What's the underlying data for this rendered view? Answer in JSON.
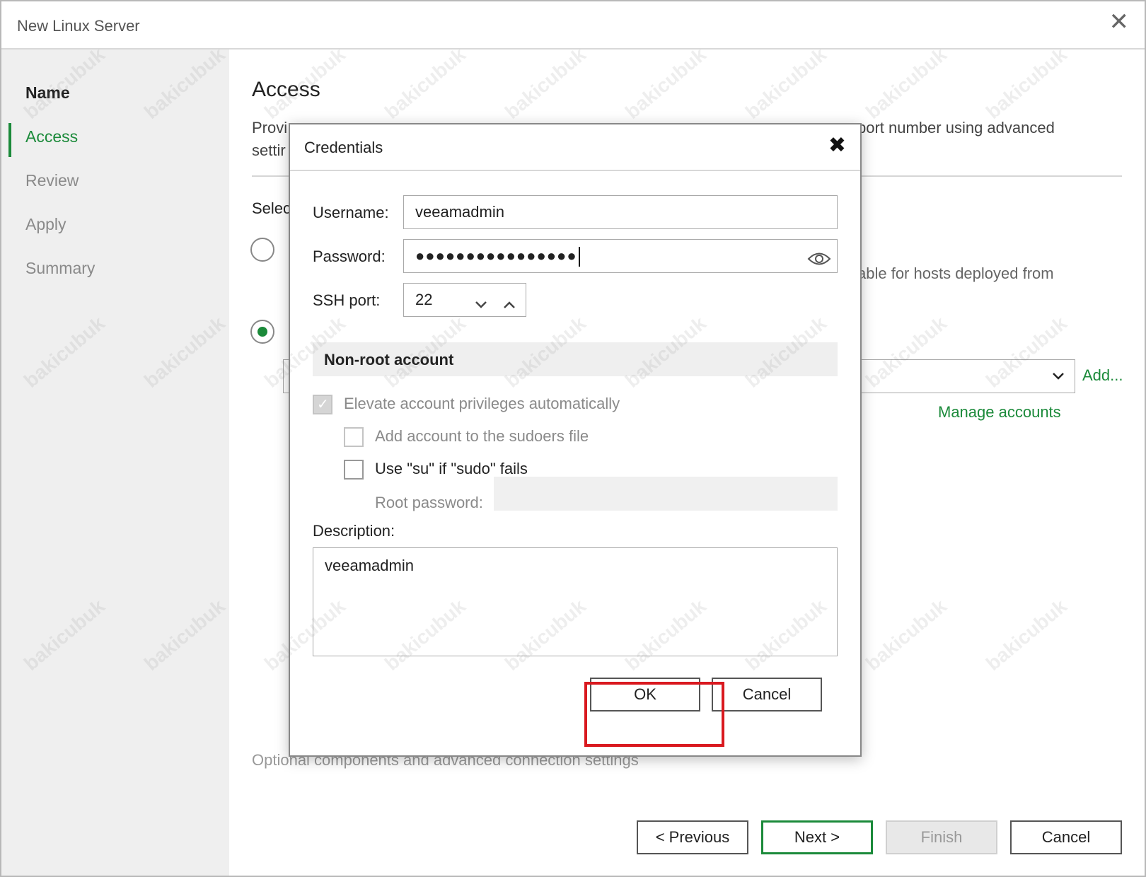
{
  "window": {
    "title": "New Linux Server",
    "close_glyph": "✕"
  },
  "sidebar": {
    "items": [
      {
        "label": "Name"
      },
      {
        "label": "Access"
      },
      {
        "label": "Review"
      },
      {
        "label": "Apply"
      },
      {
        "label": "Summary"
      }
    ]
  },
  "page": {
    "title": "Access",
    "description": "Provide credentials for ... port number using advanced settings",
    "description_left": "Provi",
    "description_left2": "settir",
    "description_right": "port number using advanced",
    "select_label": "Selec",
    "option1_tail": "able for hosts deployed from",
    "add_link": "Add...",
    "manage_link": "Manage accounts",
    "optional_link": "Optional components and advanced connection settings"
  },
  "footer": {
    "previous": "< Previous",
    "next": "Next >",
    "finish": "Finish",
    "cancel": "Cancel"
  },
  "dialog": {
    "title": "Credentials",
    "close_glyph": "✖",
    "username_label": "Username:",
    "username_value": "veeamadmin",
    "password_label": "Password:",
    "password_mask": "●●●●●●●●●●●●●●●●",
    "ssh_label": "SSH port:",
    "ssh_value": "22",
    "section_title": "Non-root account",
    "elevate_label": "Elevate account privileges automatically",
    "sudoers_label": "Add account to the sudoers file",
    "su_label": "Use \"su\" if \"sudo\" fails",
    "root_label": "Root password:",
    "description_label": "Description:",
    "description_value": "veeamadmin",
    "ok": "OK",
    "cancel": "Cancel"
  },
  "colors": {
    "accent": "#1b8a3a",
    "highlight": "#d9191f"
  },
  "watermark": "bakicubuk"
}
